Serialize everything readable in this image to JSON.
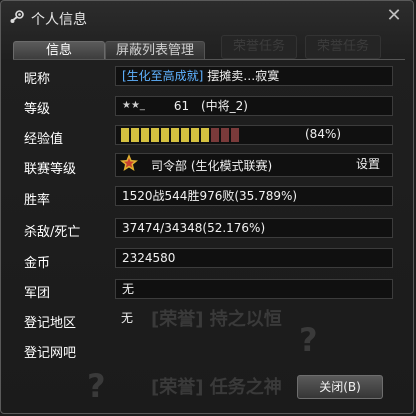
{
  "window": {
    "title": "个人信息",
    "icon": "steam-icon",
    "close_glyph": "✕"
  },
  "tabs": [
    {
      "label": "信息",
      "active": true
    },
    {
      "label": "屏蔽列表管理",
      "active": false
    }
  ],
  "background_tabs": [
    "荣誉任务",
    "荣誉任务"
  ],
  "background_text": [
    "[荣誉] 持之以恒",
    "[荣誉] 任务之神",
    "?",
    "?"
  ],
  "profile": {
    "nickname": {
      "label": "昵称",
      "tag": "[生化至高成就]",
      "name": "摆摊卖…寂寞"
    },
    "level": {
      "label": "等级",
      "rank_icon": "★★_",
      "value": "61",
      "title": "(中将_2)"
    },
    "exp": {
      "label": "经验值",
      "percent_text": "(84%)",
      "progress": 0.84,
      "filled_color": "#d4c040",
      "empty_color": "#7a3a3a"
    },
    "league": {
      "label": "联赛等级",
      "medal_icon": "star-medal-icon",
      "text": "司令部 (生化模式联赛)",
      "settings_label": "设置"
    },
    "win_rate": {
      "label": "胜率",
      "value": "1520战544胜976败(35.789%)"
    },
    "kd": {
      "label": "杀敌/死亡",
      "value": "37474/34348(52.176%)"
    },
    "gold": {
      "label": "金币",
      "value": "2324580"
    },
    "clan": {
      "label": "军团",
      "value": "无"
    },
    "region": {
      "label": "登记地区",
      "value": "无"
    },
    "netbar": {
      "label": "登记网吧",
      "value": ""
    }
  },
  "buttons": {
    "close_label": "关闭(B)"
  },
  "colors": {
    "accent_blue": "#5fb2ff",
    "medal_red": "#c8402e",
    "medal_gold": "#e0b030"
  }
}
